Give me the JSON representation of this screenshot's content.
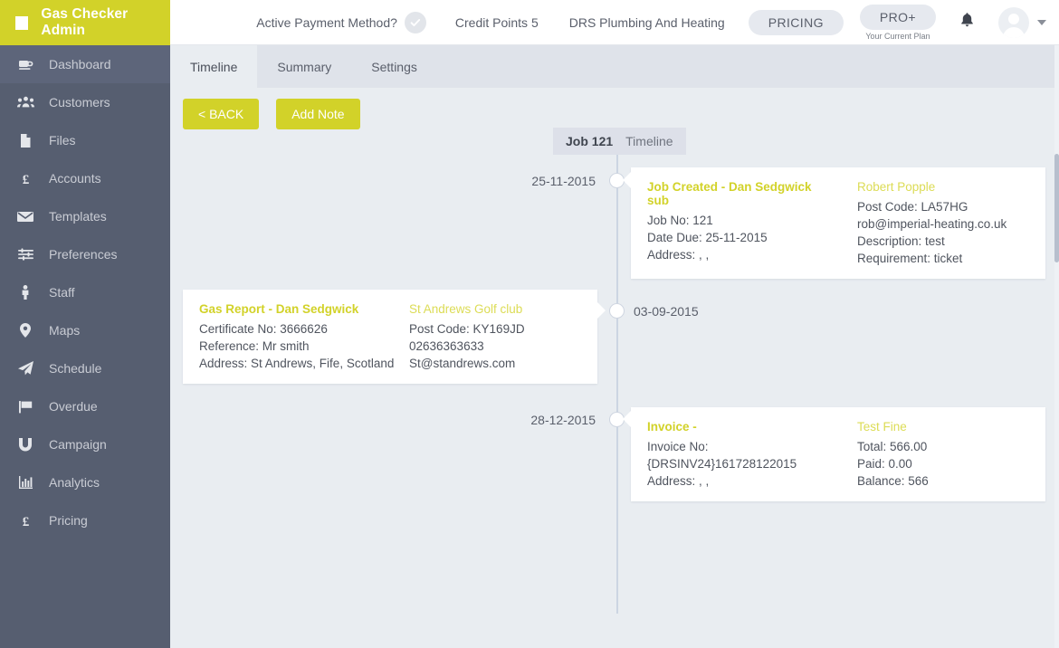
{
  "colors": {
    "brand_yellow": "#d2d229",
    "sidebar_bg": "#565e70",
    "sidebar_active": "#5d657a",
    "page_bg": "#e9edf1",
    "tabbar_bg": "#dfe3ea",
    "card_bg": "#ffffff",
    "spine": "#ccd5e2"
  },
  "sidebar": {
    "brand": "Gas Checker Admin",
    "brand_icon": "square-logo-icon",
    "items": [
      {
        "label": "Dashboard",
        "icon": "dashboard-icon",
        "active": true
      },
      {
        "label": "Customers",
        "icon": "users-icon",
        "active": false
      },
      {
        "label": "Files",
        "icon": "file-icon",
        "active": false
      },
      {
        "label": "Accounts",
        "icon": "pound-icon",
        "active": false
      },
      {
        "label": "Templates",
        "icon": "envelope-icon",
        "active": false
      },
      {
        "label": "Preferences",
        "icon": "sliders-icon",
        "active": false
      },
      {
        "label": "Staff",
        "icon": "person-icon",
        "active": false
      },
      {
        "label": "Maps",
        "icon": "map-pin-icon",
        "active": false
      },
      {
        "label": "Schedule",
        "icon": "paper-plane-icon",
        "active": false
      },
      {
        "label": "Overdue",
        "icon": "flag-icon",
        "active": false
      },
      {
        "label": "Campaign",
        "icon": "magnet-icon",
        "active": false
      },
      {
        "label": "Analytics",
        "icon": "bar-chart-icon",
        "active": false
      },
      {
        "label": "Pricing",
        "icon": "pound-icon",
        "active": false
      }
    ]
  },
  "header": {
    "payment_label": "Active Payment Method?",
    "payment_status_icon": "check-circle-icon",
    "credit_points": "Credit Points 5",
    "company": "DRS Plumbing And Heating",
    "pricing_button": "PRICING",
    "plan_badge": "PRO+",
    "plan_caption": "Your Current Plan",
    "bell_icon": "bell-icon",
    "avatar_icon": "avatar-icon",
    "caret_icon": "chevron-down-icon"
  },
  "tabs": [
    {
      "label": "Timeline",
      "active": true
    },
    {
      "label": "Summary",
      "active": false
    },
    {
      "label": "Settings",
      "active": false
    }
  ],
  "toolbar": {
    "back_label": "< BACK",
    "add_note_label": "Add Note"
  },
  "timeline": {
    "header": {
      "job_no": "Job 121",
      "view": "Timeline"
    },
    "entries": [
      {
        "date": "25-11-2015",
        "side": "right",
        "left_col": {
          "title": "Job Created - Dan Sedgwick sub",
          "lines": [
            "Job No: 121",
            "Date Due: 25-11-2015",
            "Address: , ,"
          ]
        },
        "right_col": {
          "title": "Robert Popple",
          "lines": [
            "Post Code: LA57HG",
            "rob@imperial-heating.co.uk",
            "Description: test",
            "Requirement: ticket"
          ]
        }
      },
      {
        "date": "03-09-2015",
        "side": "left",
        "left_col": {
          "title": "Gas Report - Dan Sedgwick",
          "lines": [
            "Certificate No: 3666626",
            "Reference: Mr smith",
            "Address: St Andrews, Fife, Scotland"
          ]
        },
        "right_col": {
          "title": "St Andrews Golf club",
          "lines": [
            "Post Code: KY169JD",
            "02636363633",
            "St@standrews.com"
          ]
        }
      },
      {
        "date": "28-12-2015",
        "side": "right",
        "left_col": {
          "title": "Invoice -",
          "lines": [
            "Invoice No:",
            "{DRSINV24}161728122015",
            "Address: , ,"
          ]
        },
        "right_col": {
          "title": "Test Fine",
          "lines": [
            "Total: 566.00",
            "Paid: 0.00",
            "Balance: 566"
          ]
        }
      }
    ]
  }
}
